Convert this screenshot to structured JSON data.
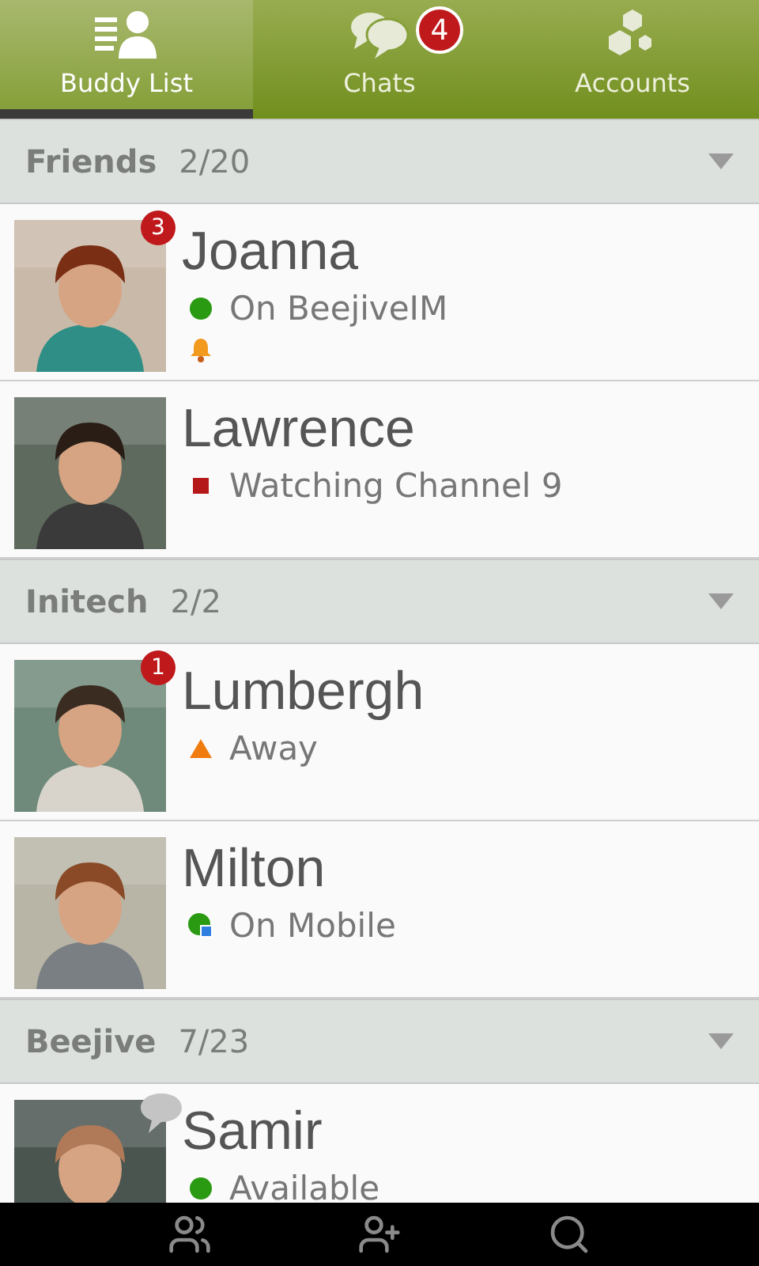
{
  "tabs": [
    {
      "label": "Buddy List",
      "selected": true
    },
    {
      "label": "Chats",
      "selected": false,
      "badge": "4"
    },
    {
      "label": "Accounts",
      "selected": false
    }
  ],
  "groups": [
    {
      "name": "Friends",
      "count": "2/20",
      "expanded": true,
      "buddies": [
        {
          "name": "Joanna",
          "kind": "online",
          "message": "On BeejiveIM",
          "unread": "3",
          "alert": true,
          "chatting": false
        },
        {
          "name": "Lawrence",
          "kind": "busy",
          "message": "Watching Channel 9",
          "alert": false,
          "chatting": false
        }
      ]
    },
    {
      "name": "Initech",
      "count": "2/2",
      "expanded": true,
      "buddies": [
        {
          "name": "Lumbergh",
          "kind": "away",
          "message": "Away",
          "unread": "1",
          "alert": false,
          "chatting": false
        },
        {
          "name": "Milton",
          "kind": "mobile",
          "message": "On Mobile",
          "alert": false,
          "chatting": false
        }
      ]
    },
    {
      "name": "Beejive",
      "count": "7/23",
      "expanded": true,
      "buddies": [
        {
          "name": "Samir",
          "kind": "online",
          "message": "Available",
          "alert": false,
          "chatting": true
        }
      ]
    }
  ]
}
